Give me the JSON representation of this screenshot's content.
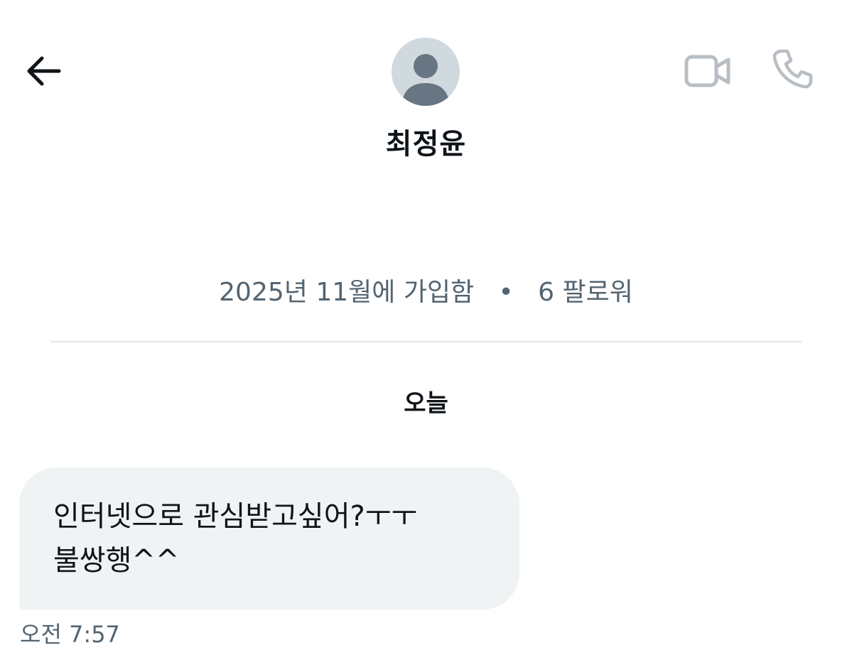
{
  "header": {
    "name": "최정윤",
    "back_icon": "back-arrow-icon",
    "video_icon": "video-camera-icon",
    "call_icon": "phone-icon"
  },
  "profile": {
    "joined": "2025년 11월에 가입함",
    "separator": "•",
    "followers": "6 팔로워"
  },
  "conversation": {
    "date_label": "오늘",
    "messages": [
      {
        "lines": [
          "인터넷으로 관심받고싶어?ㅜㅜ",
          "불쌍행^^"
        ],
        "time": "오전 7:57"
      }
    ]
  },
  "colors": {
    "background": "#ffffff",
    "bubble": "#eff3f4",
    "secondary_text": "#536471",
    "icon_gray": "#b8bec3",
    "primary_text": "#0f1419"
  }
}
